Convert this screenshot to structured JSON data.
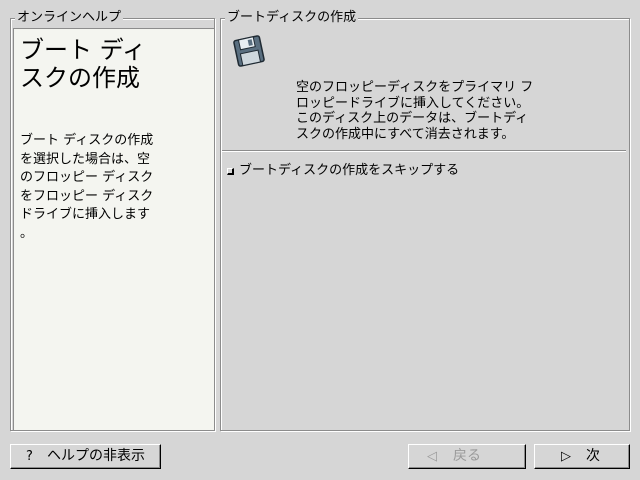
{
  "help": {
    "frame_title": "オンラインヘルプ",
    "heading": "ブート ディ\nスクの作成",
    "body": "ブート ディスクの作成\nを選択した場合は、空\nのフロッピー ディスク\nをフロッピー ディスク\nドライブに挿入します\n。"
  },
  "main": {
    "frame_title": "ブートディスクの作成",
    "icon": "floppy-disk-icon",
    "message": "空のフロッピーディスクをプライマリ フ\nロッピードライブに挿入してください。\nこのディスク上のデータは、ブートディ\nスクの作成中にすべて消去されます。",
    "skip_checkbox": {
      "label": "ブートディスクの作成をスキップする",
      "checked": false
    }
  },
  "buttons": {
    "hide_help": {
      "icon": "question-icon",
      "label": "ヘルプの非表示"
    },
    "back": {
      "icon": "left-arrow-icon",
      "label": "戻る",
      "enabled": false
    },
    "next": {
      "icon": "right-arrow-icon",
      "label": "次"
    }
  },
  "colors": {
    "background": "#d6d6d6",
    "help_panel": "#f4f5f0",
    "disabled_text": "#9a9a9a"
  }
}
